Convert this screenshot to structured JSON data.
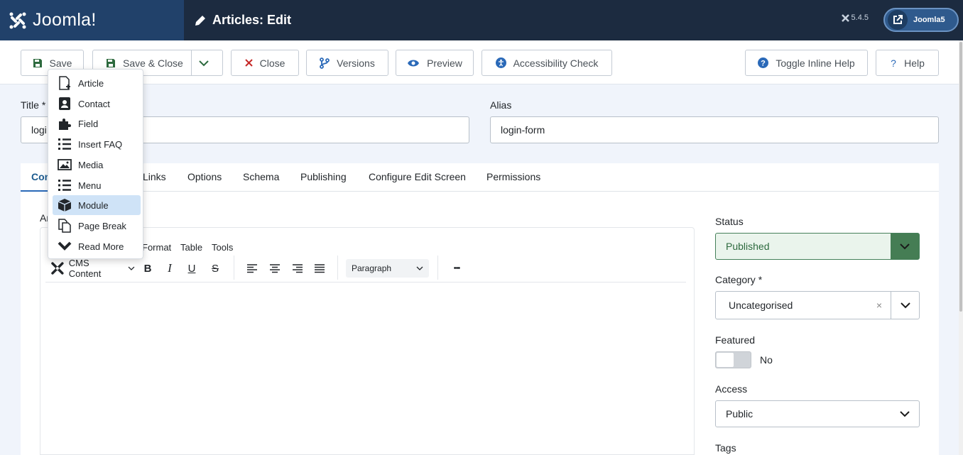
{
  "header": {
    "logo": "Joomla!",
    "title": "Articles: Edit",
    "version": "5.4.5",
    "user_label": "Joomla5"
  },
  "toolbar": {
    "save": "Save",
    "save_close": "Save & Close",
    "close": "Close",
    "versions": "Versions",
    "preview": "Preview",
    "accessibility": "Accessibility Check",
    "toggle_help": "Toggle Inline Help",
    "help": "Help"
  },
  "form": {
    "title_label": "Title *",
    "title_value": "logi",
    "alias_label": "Alias",
    "alias_value": "login-form"
  },
  "tabs": [
    "Con",
    "Links",
    "Options",
    "Schema",
    "Publishing",
    "Configure Edit Screen",
    "Permissions"
  ],
  "editor": {
    "label_fragment": "Ar",
    "menus": [
      "Format",
      "Table",
      "Tools"
    ],
    "cms_content": "CMS Content",
    "paragraph": "Paragraph",
    "more": "•••"
  },
  "dropdown": {
    "items": [
      "Article",
      "Contact",
      "Field",
      "Insert FAQ",
      "Media",
      "Menu",
      "Module",
      "Page Break",
      "Read More"
    ],
    "highlighted": "Module"
  },
  "sidebar": {
    "status_label": "Status",
    "status_value": "Published",
    "category_label": "Category *",
    "category_value": "Uncategorised",
    "clear": "×",
    "featured_label": "Featured",
    "featured_value": "No",
    "access_label": "Access",
    "access_value": "Public",
    "tags_label": "Tags"
  },
  "colors": {
    "header_bg": "#1c2b40",
    "logo_bg": "#21416a",
    "accent": "#2a69b8",
    "status_green": "#457d54",
    "highlight": "#cfe3f7"
  }
}
